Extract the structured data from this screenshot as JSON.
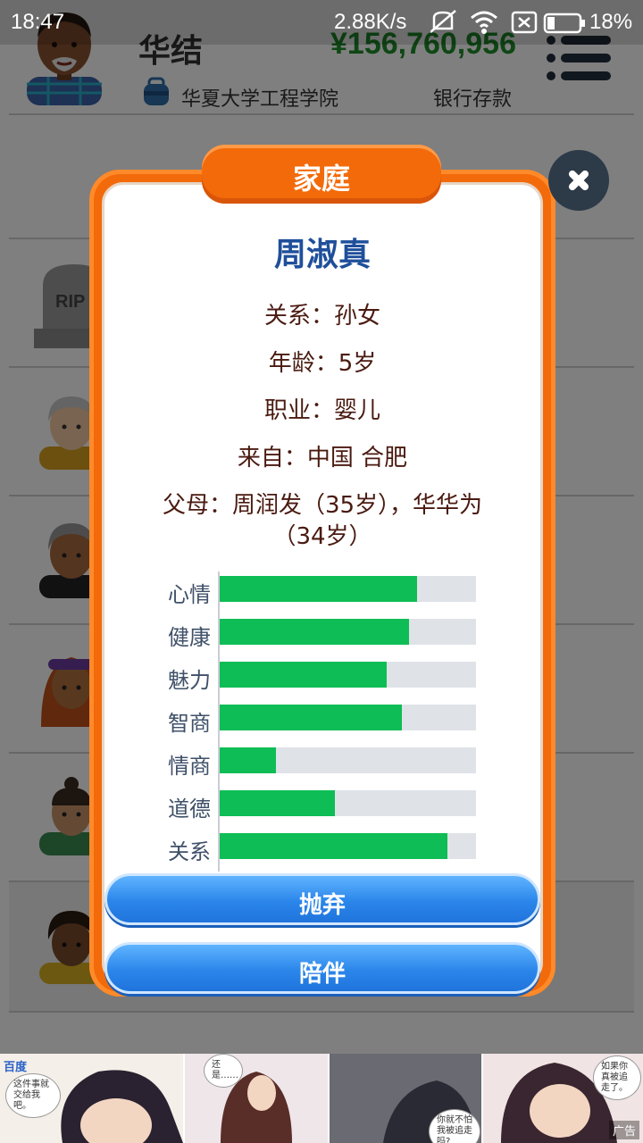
{
  "statusbar": {
    "time": "18:47",
    "net_speed": "2.88K/s",
    "battery": "18%",
    "icons": [
      "mute-icon",
      "wifi-icon",
      "sim-off-icon",
      "battery-icon"
    ]
  },
  "header": {
    "player_name": "华结",
    "money": "¥156,760,956",
    "school": "华夏大学工程学院",
    "bank_label": "银行存款"
  },
  "background_list": {
    "rows": [
      "deceased-member",
      "grandmother",
      "elderly-woman",
      "woman",
      "man",
      "girl"
    ],
    "rip_text": "RIP"
  },
  "dialog": {
    "title": "家庭",
    "name": "周淑真",
    "info": {
      "relation": "关系：孙女",
      "age": "年龄：5岁",
      "job": "职业：婴儿",
      "origin": "来自：中国 合肥",
      "parents_line1": "父母：周润发（35岁），华华为",
      "parents_line2": "（34岁）"
    },
    "stats": [
      {
        "label": "心情",
        "value": 0.77
      },
      {
        "label": "健康",
        "value": 0.74
      },
      {
        "label": "魅力",
        "value": 0.65
      },
      {
        "label": "智商",
        "value": 0.71
      },
      {
        "label": "情商",
        "value": 0.22
      },
      {
        "label": "道德",
        "value": 0.45
      },
      {
        "label": "关系",
        "value": 0.89
      }
    ],
    "buttons": {
      "abandon": "抛弃",
      "accompany": "陪伴"
    }
  },
  "ad": {
    "brand": "百度",
    "bubble1": "这件事就交给我吧。",
    "bubble2": "还是……",
    "bubble3": "你就不怕我被追走吗?",
    "bubble4": "如果你真被追走了。",
    "label": "广告"
  },
  "colors": {
    "dialog_orange": "#f36a0a",
    "name_blue": "#1f4f9a",
    "bar_green": "#0ebd55",
    "bar_track": "#dfe3e8",
    "button_blue": "#2b86ea",
    "money_green": "#1e8f2a"
  }
}
